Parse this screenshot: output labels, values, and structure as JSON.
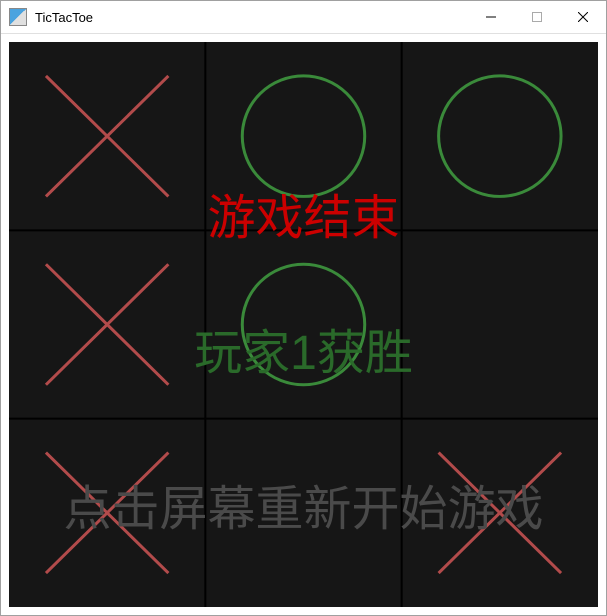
{
  "window": {
    "title": "TicTacToe"
  },
  "icons": {
    "minimize": "—",
    "maximize": "▢",
    "close": "✕"
  },
  "messages": {
    "game_over": "游戏结束",
    "winner": "玩家1获胜",
    "restart_hint": "点击屏幕重新开始游戏"
  },
  "board": {
    "grid": [
      [
        "X",
        "O",
        "O"
      ],
      [
        "X",
        "O",
        ""
      ],
      [
        "X",
        "",
        "X"
      ]
    ],
    "colors": {
      "x_stroke": "#b24b4b",
      "o_stroke": "#3a8a3a",
      "grid_line": "#000000",
      "bg": "#161616"
    }
  }
}
